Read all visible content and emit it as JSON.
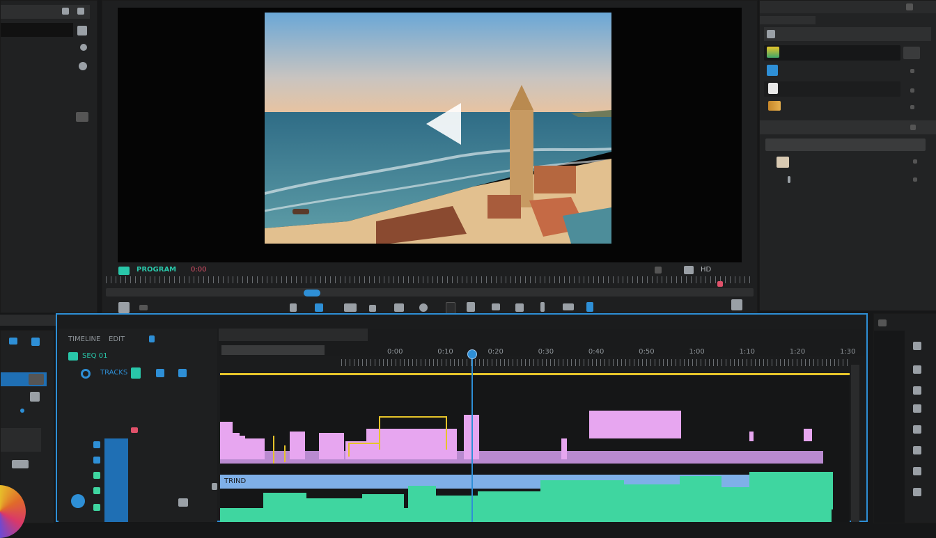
{
  "program": {
    "label": "PROGRAM",
    "timecode": "0:00",
    "resolution": "HD"
  },
  "timeline": {
    "header_left": "TIMELINE",
    "header_right": "EDIT",
    "sequence_label": "SEQ 01",
    "track_label": "TRACKS",
    "ruler_labels": [
      "0:00",
      "0:10",
      "0:20",
      "0:30",
      "0:40",
      "0:50",
      "1:00",
      "1:10",
      "1:20",
      "1:30"
    ],
    "audio_track_label": "TRIND",
    "playhead_fraction": 0.4
  },
  "colors": {
    "accent": "#2e8fd6",
    "clip_video": "#e7a6f0",
    "clip_pink_lane": "#b98ad0",
    "clip_blue_lane": "#7fb0e8",
    "clip_audio": "#3fd6a0",
    "marker_yellow": "#e6c42a"
  }
}
